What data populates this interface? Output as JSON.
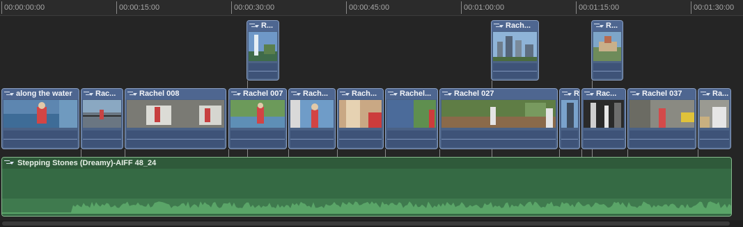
{
  "ruler": {
    "ticks": [
      "00:00:00:00",
      "00:00:15:00",
      "00:00:30:00",
      "00:00:45:00",
      "00:01:00:00",
      "00:01:15:00",
      "00:01:30:00"
    ]
  },
  "connected_clips": [
    {
      "title": "R..."
    },
    {
      "title": "Rach..."
    },
    {
      "title": "R..."
    }
  ],
  "primary_clips": [
    {
      "title": "along the water"
    },
    {
      "title": "Rac..."
    },
    {
      "title": "Rachel 008"
    },
    {
      "title": "Rachel 007"
    },
    {
      "title": "Rach..."
    },
    {
      "title": "Rach..."
    },
    {
      "title": "Rachel..."
    },
    {
      "title": "Rachel 027"
    },
    {
      "title": "R"
    },
    {
      "title": "Rac..."
    },
    {
      "title": "Rachel 037"
    },
    {
      "title": "Ra..."
    }
  ],
  "audio_clip": {
    "title": "Stepping Stones (Dreamy)-AIFF 48_24"
  },
  "colors": {
    "video_clip": "#4a6185",
    "audio_clip": "#3a6641",
    "background": "#262626"
  }
}
